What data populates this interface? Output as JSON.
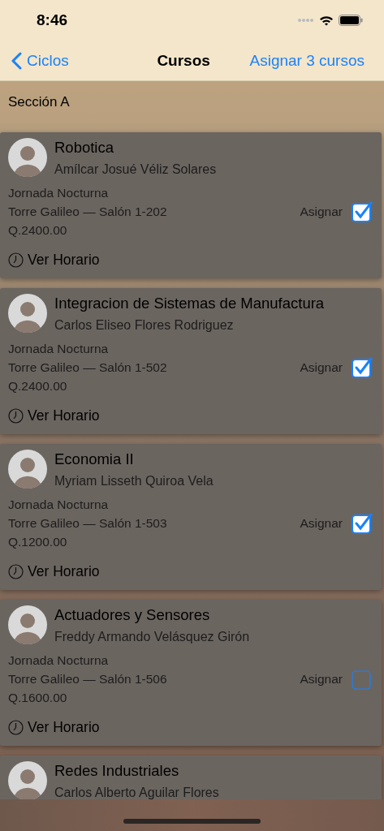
{
  "status_bar": {
    "time": "8:46"
  },
  "nav_bar": {
    "back": "Ciclos",
    "title": "Cursos",
    "action": "Asignar 3 cursos"
  },
  "section": {
    "title": "Sección A"
  },
  "courses": [
    {
      "name": "Robotica",
      "teacher": "Amílcar Josué Véliz Solares",
      "schedule": "Jornada Nocturna",
      "room": "Torre Galileo — Salón 1-202",
      "price": "Q.2400.00",
      "assign_label": "Asignar",
      "checked": true,
      "link": "Ver Horario"
    },
    {
      "name": "Integracion de Sistemas de Manufactura",
      "teacher": "Carlos Eliseo Flores Rodriguez",
      "schedule": "Jornada Nocturna",
      "room": "Torre Galileo — Salón 1-502",
      "price": "Q.2400.00",
      "assign_label": "Asignar",
      "checked": true,
      "link": "Ver Horario"
    },
    {
      "name": "Economia II",
      "teacher": "Myriam Lisseth Quiroa Vela",
      "schedule": "Jornada Nocturna",
      "room": "Torre Galileo — Salón 1-503",
      "price": "Q.1200.00",
      "assign_label": "Asignar",
      "checked": true,
      "link": "Ver Horario"
    },
    {
      "name": "Actuadores y Sensores",
      "teacher": "Freddy Armando Velásquez Girón",
      "schedule": "Jornada Nocturna",
      "room": "Torre Galileo — Salón 1-506",
      "price": "Q.1600.00",
      "assign_label": "Asignar",
      "checked": false,
      "link": "Ver Horario"
    },
    {
      "name": "Redes Industriales",
      "teacher": "Carlos Alberto Aguilar Flores"
    }
  ]
}
